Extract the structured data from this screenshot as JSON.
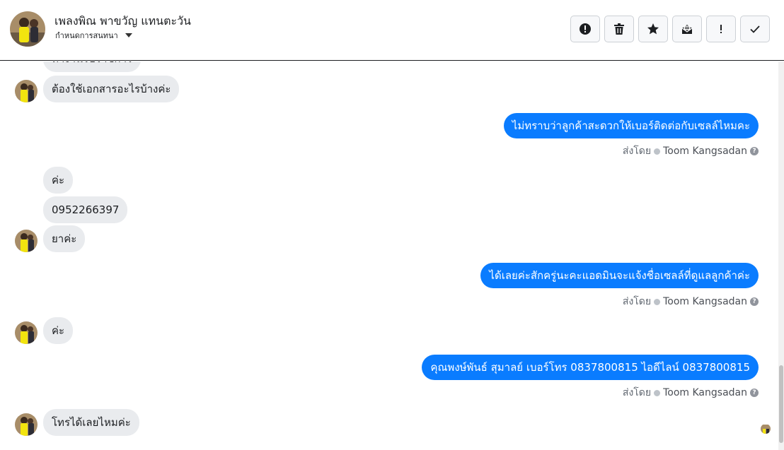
{
  "header": {
    "contact_name": "เพลงพิณ พาขวัญ แทนตะวัน",
    "assign_label": "กำหนดการสนทนา"
  },
  "toolbar": {
    "buttons": [
      {
        "icon": "alert-circle-icon"
      },
      {
        "icon": "trash-icon"
      },
      {
        "icon": "star-icon"
      },
      {
        "icon": "mark-unread-icon"
      },
      {
        "icon": "exclamation-icon"
      },
      {
        "icon": "check-icon"
      }
    ]
  },
  "messages": {
    "m0": "ทางานรับราชการ",
    "m1": "ต้องใช้เอกสารอะไรบ้างค่ะ",
    "m2": "ไม่ทราบว่าลูกค้าสะดวกให้เบอร์ติดต่อกับเซลล์ไหมคะ",
    "m3": "ค่ะ",
    "m4": "0952266397",
    "m5": "ยาค่ะ",
    "m6": "ได้เลยค่ะสักครู่นะคะแอดมินจะแจ้งชื่อเซลล์ที่ดูแลลูกค้าค่ะ",
    "m7": "ค่ะ",
    "m8": "คุณพงษ์พันธ์ สุมาลย์      เบอร์โทร 0837800815  ไอดีไลน์ 0837800815",
    "m9": "โทรได้เลยไหมค่ะ"
  },
  "sent_by": {
    "label": "ส่งโดย",
    "agent": "Toom Kangsadan"
  },
  "colors": {
    "outgoing": "#0a7cff",
    "incoming": "#e9ebee"
  }
}
